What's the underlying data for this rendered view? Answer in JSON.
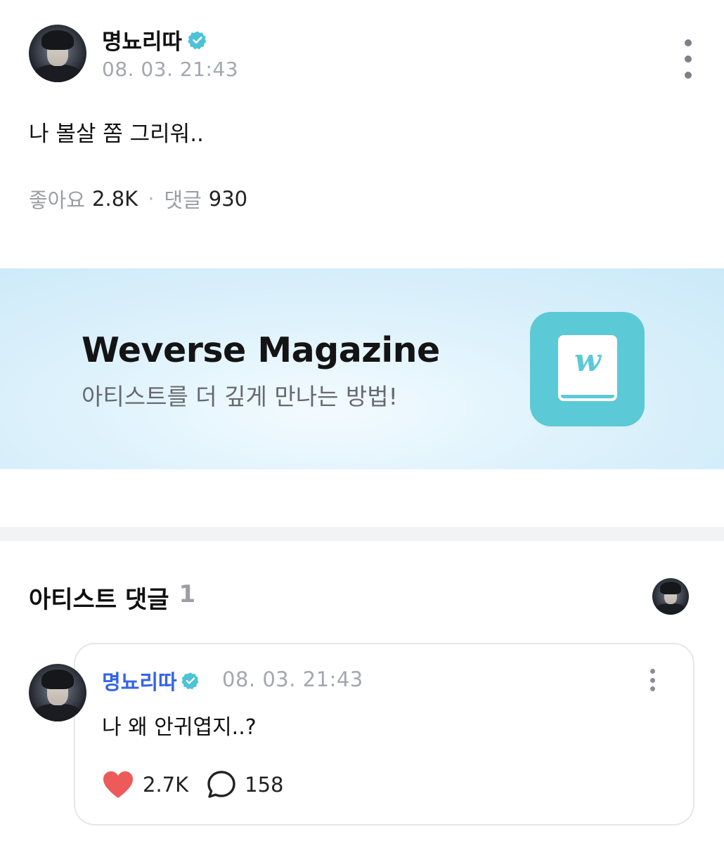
{
  "post": {
    "author": "명뇨리따",
    "timestamp": "08. 03. 21:43",
    "body": "나 볼살 쫌 그리워..",
    "likes_label": "좋아요",
    "likes_count": "2.8K",
    "separator": "·",
    "comments_label": "댓글",
    "comments_count": "930",
    "verified_icon": "verified-badge-icon",
    "more_icon": "vertical-ellipsis-icon"
  },
  "banner": {
    "title": "Weverse Magazine",
    "subtitle": "아티스트를 더 깊게 만나는 방법!",
    "icon_letter": "w",
    "icon_color": "#5cc9d6"
  },
  "artist_comments": {
    "title": "아티스트 댓글",
    "count": "1",
    "comment": {
      "author": "명뇨리따",
      "timestamp": "08. 03. 21:43",
      "body": "나 왜 안귀엽지..?",
      "likes": "2.7K",
      "replies": "158",
      "author_color": "#3564e8",
      "like_icon": "heart-icon",
      "like_color": "#ee5a5a",
      "reply_icon": "speech-bubble-icon"
    }
  },
  "colors": {
    "verified": "#4cc3d6",
    "muted_text": "#a4a7ad",
    "divider": "#f2f3f5"
  }
}
